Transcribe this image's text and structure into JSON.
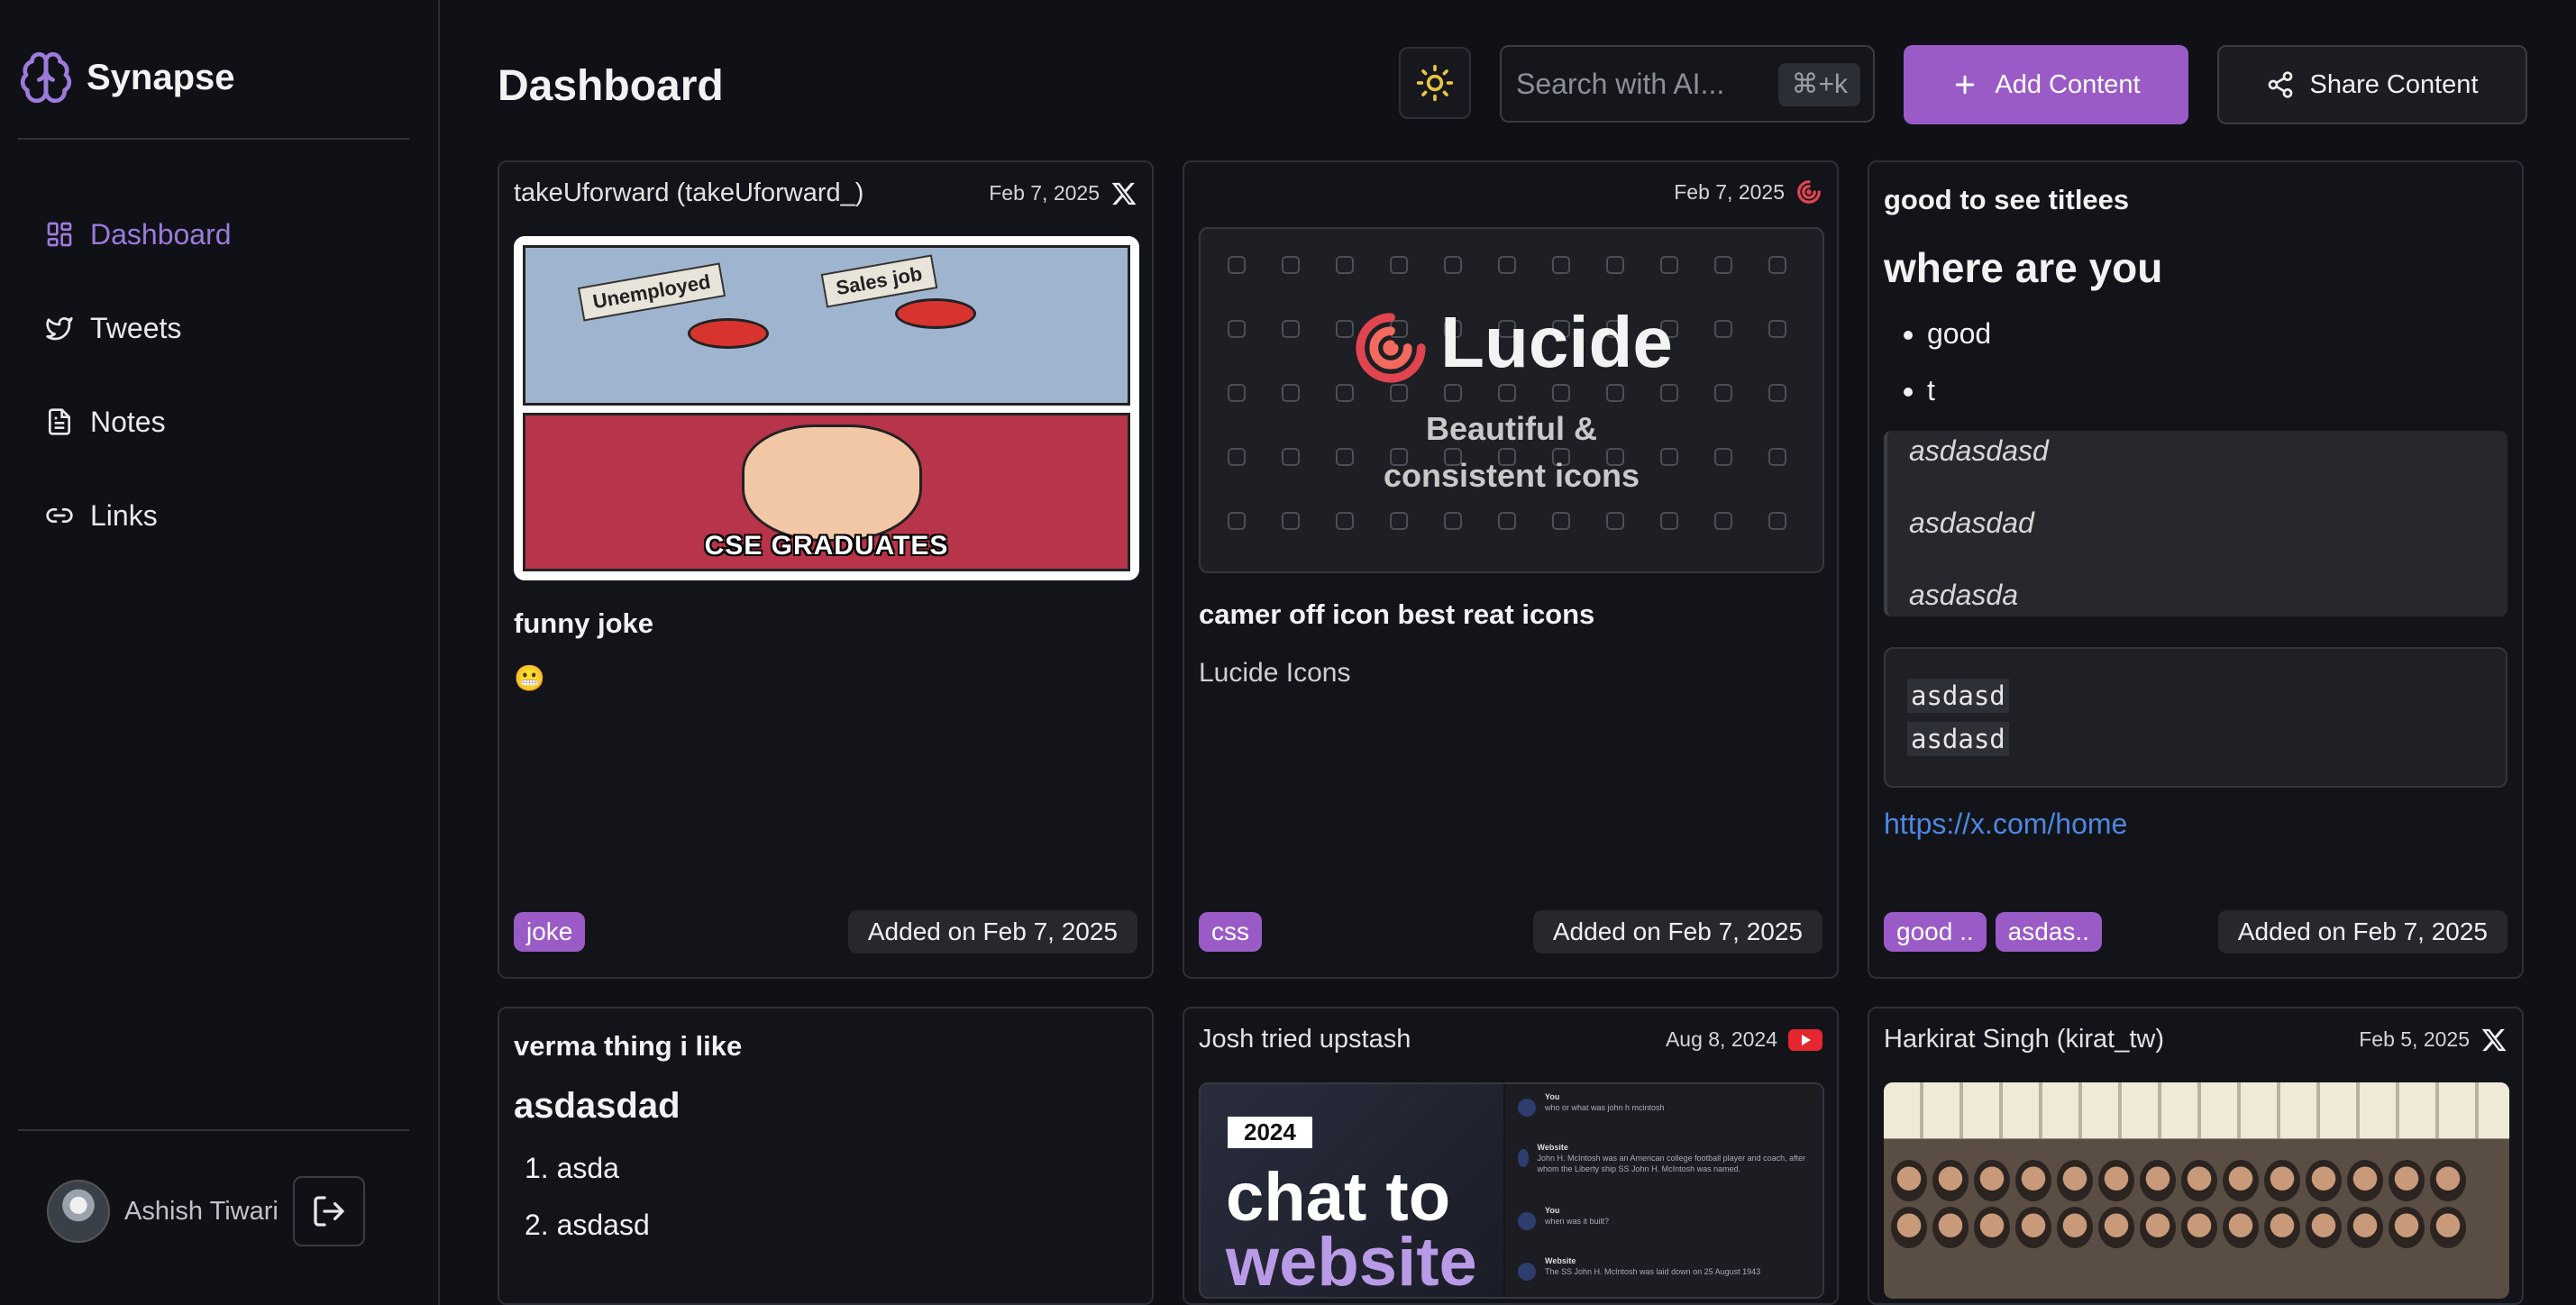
{
  "brand": {
    "name": "Synapse"
  },
  "sidebar": {
    "items": [
      {
        "label": "Dashboard",
        "icon": "dashboard-icon",
        "active": true
      },
      {
        "label": "Tweets",
        "icon": "twitter-icon"
      },
      {
        "label": "Notes",
        "icon": "file-text-icon"
      },
      {
        "label": "Links",
        "icon": "link-icon"
      }
    ],
    "user_name": "Ashish Tiwari"
  },
  "header": {
    "title": "Dashboard",
    "search_placeholder": "Search with AI...",
    "search_shortcut": "⌘+k",
    "add_label": "Add Content",
    "share_label": "Share Content"
  },
  "colors": {
    "accent": "#9b5bc7",
    "nav_active": "#9c7bdb",
    "link": "#4f86e0"
  },
  "cards": {
    "c1": {
      "author": "takeUforward (takeUforward_)",
      "date": "Feb 7, 2025",
      "source_icon": "x-icon",
      "meme": {
        "left_button": "Unemployed",
        "right_button": "Sales job",
        "caption": "CSE GRADUATES"
      },
      "title": "funny joke",
      "emoji": "😬",
      "tags": [
        "joke"
      ],
      "added": "Added on Feb 7, 2025"
    },
    "c2": {
      "date": "Feb 7, 2025",
      "source_icon": "lucide-icon",
      "preview": {
        "logo": "Lucide",
        "subtitle_line1": "Beautiful &",
        "subtitle_line2": "consistent icons"
      },
      "title": "camer off icon best reat icons",
      "description": "Lucide Icons",
      "tags": [
        "css"
      ],
      "added": "Added on Feb 7, 2025"
    },
    "c3": {
      "title": "good to see titlees",
      "heading": "where are you",
      "bullets": [
        "good",
        "t"
      ],
      "quote_lines": [
        "asdasdasd",
        "asdasdad",
        "asdasda"
      ],
      "code_lines": [
        "asdasd",
        "asdasd"
      ],
      "link": "https://x.com/home",
      "tags": [
        "good ..",
        "asdas.."
      ],
      "added": "Added on Feb 7, 2025"
    },
    "c4": {
      "title": "verma thing i like",
      "heading": "asdasdad",
      "numbered": [
        "asda",
        "asdasd"
      ]
    },
    "c5": {
      "author": "Josh tried upstash",
      "date": "Aug 8, 2024",
      "source_icon": "youtube-icon",
      "thumb": {
        "year": "2024",
        "line1": "chat to",
        "line2": "website"
      },
      "chat": [
        {
          "who": "You",
          "text": "who or what was john h mcintosh"
        },
        {
          "who": "Website",
          "text": "John H. McIntosh was an American college football player and coach, after whom the Liberty ship SS John H. McIntosh was named."
        },
        {
          "who": "You",
          "text": "when was it built?"
        },
        {
          "who": "Website",
          "text": "The SS John H. McIntosh was laid down on 25 August 1943"
        }
      ]
    },
    "c6": {
      "author": "Harkirat Singh (kirat_tw)",
      "date": "Feb 5, 2025",
      "source_icon": "x-icon"
    }
  }
}
